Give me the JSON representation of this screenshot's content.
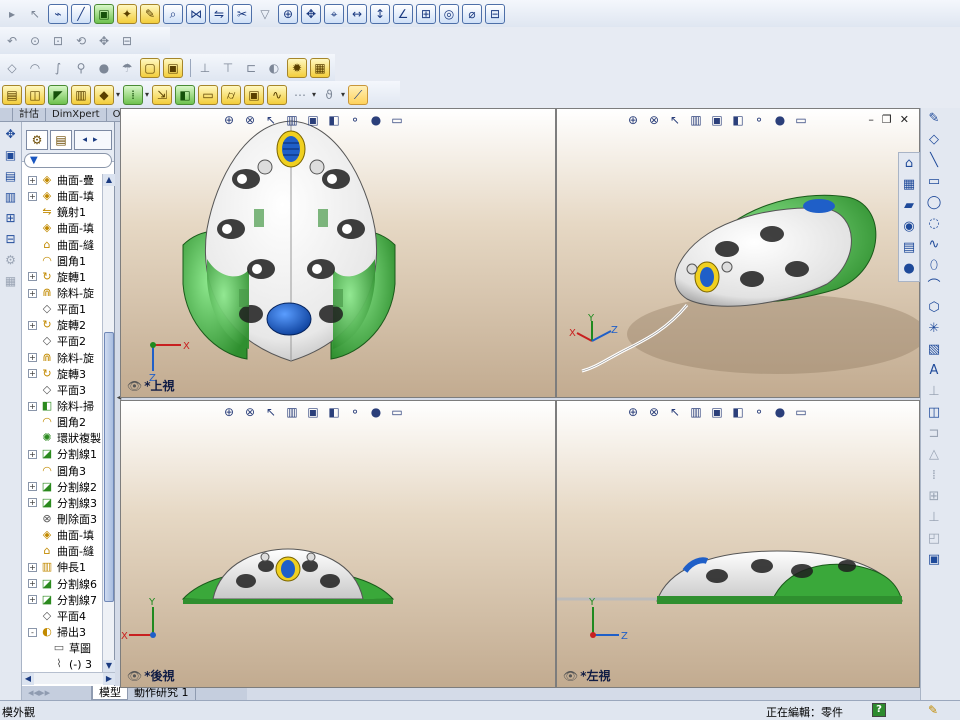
{
  "toolbars": {
    "row1": [
      "arrow-small",
      "pointer",
      "fix-sketch",
      "line-tool",
      "note",
      "pin",
      "relation-a",
      "relation-b",
      "trim",
      "funnel",
      "offset-a",
      "offset-b",
      "dim-a",
      "dim-b",
      "dim-c",
      "dim-d",
      "dim-e",
      "dim-f",
      "dim-g",
      "dim-h"
    ],
    "row2_count": 9,
    "row3_count": 14,
    "row4_count": 12
  },
  "command_tabs": [
    "計估",
    "DimXpert",
    "Office 產品"
  ],
  "feature_tree": {
    "filter_icon": "funnel-icon",
    "items": [
      {
        "label": "曲面-疊",
        "icon": "surface",
        "expand": "+"
      },
      {
        "label": "曲面-填",
        "icon": "surface",
        "expand": "+"
      },
      {
        "label": "鏡射1",
        "icon": "mirror",
        "expand": ""
      },
      {
        "label": "曲面-填",
        "icon": "surface",
        "expand": ""
      },
      {
        "label": "曲面-縫",
        "icon": "knit",
        "expand": ""
      },
      {
        "label": "圓角1",
        "icon": "fillet",
        "expand": ""
      },
      {
        "label": "旋轉1",
        "icon": "revolve",
        "expand": "+"
      },
      {
        "label": "除料-旋",
        "icon": "cut",
        "expand": "+"
      },
      {
        "label": "平面1",
        "icon": "plane",
        "expand": ""
      },
      {
        "label": "旋轉2",
        "icon": "revolve",
        "expand": "+"
      },
      {
        "label": "平面2",
        "icon": "plane",
        "expand": ""
      },
      {
        "label": "除料-旋",
        "icon": "cut",
        "expand": "+"
      },
      {
        "label": "旋轉3",
        "icon": "revolve",
        "expand": "+"
      },
      {
        "label": "平面3",
        "icon": "plane",
        "expand": ""
      },
      {
        "label": "除料-掃",
        "icon": "sweep-cut",
        "expand": "+"
      },
      {
        "label": "圓角2",
        "icon": "fillet",
        "expand": ""
      },
      {
        "label": "環狀複製",
        "icon": "pattern",
        "expand": ""
      },
      {
        "label": "分割線1",
        "icon": "split",
        "expand": "+"
      },
      {
        "label": "圓角3",
        "icon": "fillet",
        "expand": ""
      },
      {
        "label": "分割線2",
        "icon": "split",
        "expand": "+"
      },
      {
        "label": "分割線3",
        "icon": "split",
        "expand": "+"
      },
      {
        "label": "刪除面3",
        "icon": "delete-face",
        "expand": ""
      },
      {
        "label": "曲面-填",
        "icon": "surface",
        "expand": ""
      },
      {
        "label": "曲面-縫",
        "icon": "knit",
        "expand": ""
      },
      {
        "label": "伸長1",
        "icon": "extrude",
        "expand": "+"
      },
      {
        "label": "分割線6",
        "icon": "split",
        "expand": "+"
      },
      {
        "label": "分割線7",
        "icon": "split",
        "expand": "+"
      },
      {
        "label": "平面4",
        "icon": "plane",
        "expand": ""
      },
      {
        "label": "掃出3",
        "icon": "sweep",
        "expand": "-"
      },
      {
        "label": "草圖",
        "icon": "sketch",
        "expand": "",
        "indent": true
      },
      {
        "label": "(-) 3",
        "icon": "3d-sketch",
        "expand": "",
        "indent": true
      }
    ]
  },
  "bottom_tabs": [
    "模型",
    "動作研究 1"
  ],
  "viewports": {
    "top": {
      "label": "*上視"
    },
    "iso": {
      "label": ""
    },
    "back": {
      "label": "*後視"
    },
    "left": {
      "label": "*左視"
    }
  },
  "triad_labels": {
    "x": "X",
    "y": "Y",
    "z": "Z"
  },
  "status": {
    "left": "模外觀",
    "right": "正在編輯：零件",
    "help": "?"
  },
  "colors": {
    "accent_green": "#3aa83a",
    "body_white": "#f2f2f2",
    "blue_button": "#1f5fc8",
    "bg_top": "#ffffff",
    "bg_bottom": "#c2ab90"
  }
}
